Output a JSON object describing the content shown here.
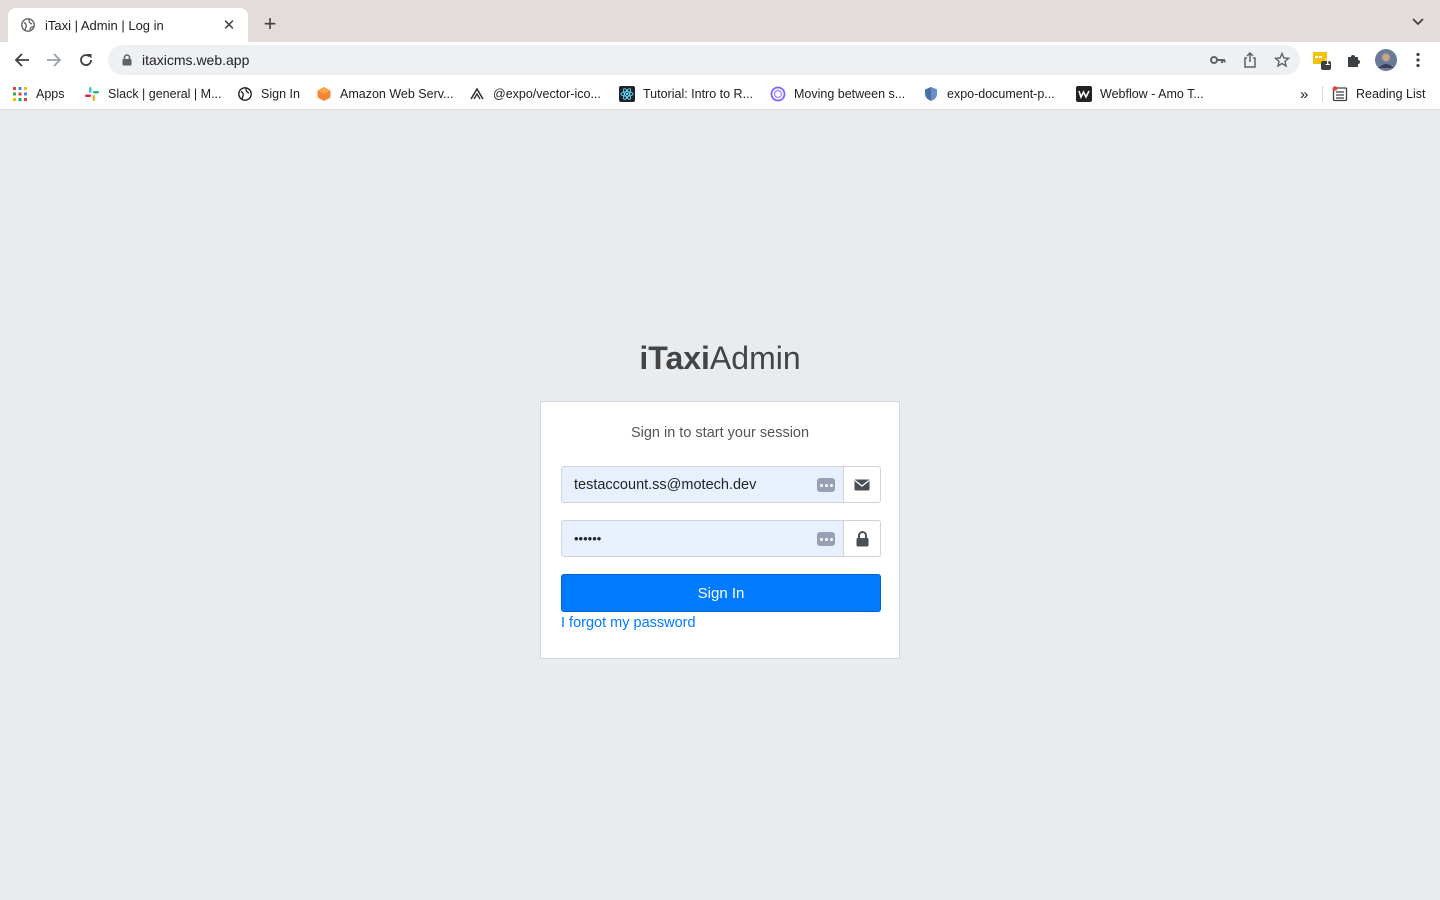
{
  "browser": {
    "tab": {
      "title": "iTaxi | Admin | Log in",
      "close_glyph": "✕",
      "favicon": "globe-icon"
    },
    "new_tab_glyph": "+",
    "url": "itaxicms.web.app",
    "extension_badge": "1"
  },
  "bookmarks": {
    "items": [
      {
        "label": "Apps",
        "icon": "apps-grid-icon"
      },
      {
        "label": "Slack | general | M...",
        "icon": "slack-icon"
      },
      {
        "label": "Sign In",
        "icon": "globe-icon"
      },
      {
        "label": "Amazon Web Serv...",
        "icon": "aws-icon"
      },
      {
        "label": "@expo/vector-ico...",
        "icon": "expo-icon"
      },
      {
        "label": "Tutorial: Intro to R...",
        "icon": "react-icon"
      },
      {
        "label": "Moving between s...",
        "icon": "circle-icon"
      },
      {
        "label": "expo-document-p...",
        "icon": "shield-icon"
      },
      {
        "label": "Webflow - Amo T...",
        "icon": "webflow-icon"
      }
    ],
    "overflow_glyph": "»",
    "reading_list": "Reading List"
  },
  "login": {
    "logo_bold": "iTaxi",
    "logo_light": "Admin",
    "message": "Sign in to start your session",
    "email_value": "testaccount.ss@motech.dev",
    "password_value": "••••••",
    "signin_label": "Sign In",
    "forgot_label": "I forgot my password"
  },
  "colors": {
    "primary": "#007bff",
    "page_bg": "#e9ecef",
    "autofill_bg": "#e8f0fe"
  }
}
